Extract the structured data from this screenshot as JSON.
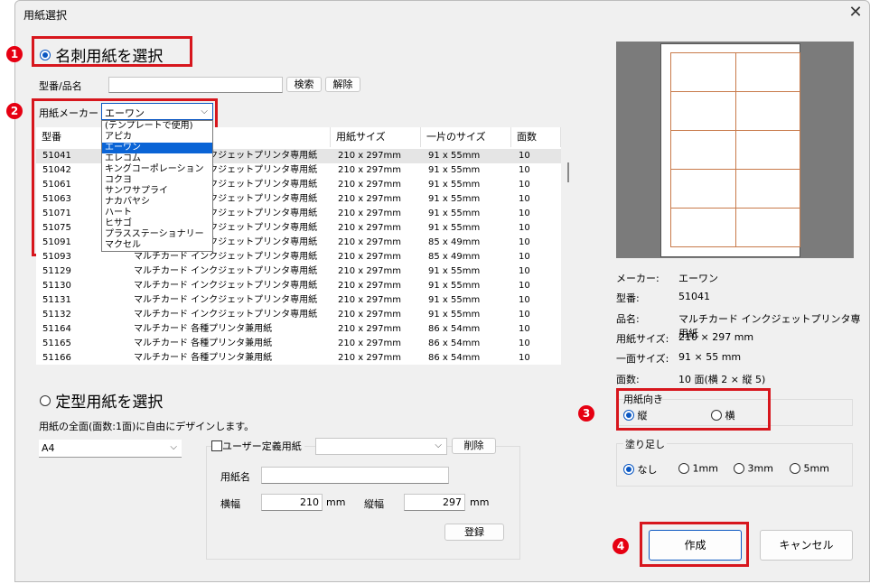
{
  "window": {
    "title": "用紙選択",
    "close_glyph": "✕"
  },
  "badges": {
    "b1": "1",
    "b2": "2",
    "b3": "3",
    "b4": "4"
  },
  "meishi": {
    "label": "名刺用紙を選択",
    "search_label": "型番/品名",
    "search_button": "検索",
    "clear_button": "解除",
    "maker_label": "用紙メーカー",
    "maker_value": "エーワン"
  },
  "maker_options": [
    "(テンプレートで使用)",
    "アピカ",
    "エーワン",
    "エレコム",
    "キングコーポレーション",
    "コクヨ",
    "サンワサプライ",
    "ナカバヤシ",
    "ハート",
    "ヒサゴ",
    "プラスステーショナリー",
    "マクセル"
  ],
  "columns": [
    "型番",
    "品名",
    "用紙サイズ",
    "一片のサイズ",
    "面数"
  ],
  "rows": [
    {
      "no": "51041",
      "name": "マルチカード インクジェットプリンタ専用紙",
      "size": "210 x 297mm",
      "piece": "91 x 55mm",
      "count": "10"
    },
    {
      "no": "51042",
      "name": "マルチカード インクジェットプリンタ専用紙",
      "size": "210 x 297mm",
      "piece": "91 x 55mm",
      "count": "10"
    },
    {
      "no": "51061",
      "name": "マルチカード インクジェットプリンタ専用紙",
      "size": "210 x 297mm",
      "piece": "91 x 55mm",
      "count": "10"
    },
    {
      "no": "51063",
      "name": "マルチカード インクジェットプリンタ専用紙",
      "size": "210 x 297mm",
      "piece": "91 x 55mm",
      "count": "10"
    },
    {
      "no": "51071",
      "name": "マルチカード インクジェットプリンタ専用紙",
      "size": "210 x 297mm",
      "piece": "91 x 55mm",
      "count": "10"
    },
    {
      "no": "51075",
      "name": "マルチカード インクジェットプリンタ専用紙",
      "size": "210 x 297mm",
      "piece": "91 x 55mm",
      "count": "10"
    },
    {
      "no": "51091",
      "name": "マルチカード インクジェットプリンタ専用紙",
      "size": "210 x 297mm",
      "piece": "85 x 49mm",
      "count": "10"
    },
    {
      "no": "51093",
      "name": "マルチカード インクジェットプリンタ専用紙",
      "size": "210 x 297mm",
      "piece": "85 x 49mm",
      "count": "10"
    },
    {
      "no": "51129",
      "name": "マルチカード インクジェットプリンタ専用紙",
      "size": "210 x 297mm",
      "piece": "91 x 55mm",
      "count": "10"
    },
    {
      "no": "51130",
      "name": "マルチカード インクジェットプリンタ専用紙",
      "size": "210 x 297mm",
      "piece": "91 x 55mm",
      "count": "10"
    },
    {
      "no": "51131",
      "name": "マルチカード インクジェットプリンタ専用紙",
      "size": "210 x 297mm",
      "piece": "91 x 55mm",
      "count": "10"
    },
    {
      "no": "51132",
      "name": "マルチカード インクジェットプリンタ専用紙",
      "size": "210 x 297mm",
      "piece": "91 x 55mm",
      "count": "10"
    },
    {
      "no": "51164",
      "name": "マルチカード 各種プリンタ兼用紙",
      "size": "210 x 297mm",
      "piece": "86 x 54mm",
      "count": "10"
    },
    {
      "no": "51165",
      "name": "マルチカード 各種プリンタ兼用紙",
      "size": "210 x 297mm",
      "piece": "86 x 54mm",
      "count": "10"
    },
    {
      "no": "51166",
      "name": "マルチカード 各種プリンタ兼用紙",
      "size": "210 x 297mm",
      "piece": "86 x 54mm",
      "count": "10"
    }
  ],
  "teikei": {
    "label": "定型用紙を選択",
    "desc": "用紙の全面(面数:1面)に自由にデザインします。",
    "size_value": "A4",
    "user_label": "ユーザー定義用紙",
    "delete_button": "削除",
    "name_label": "用紙名",
    "width_label": "横幅",
    "width_value": "210",
    "width_unit": "mm",
    "height_label": "縦幅",
    "height_value": "297",
    "height_unit": "mm",
    "register_button": "登録"
  },
  "info": [
    {
      "k": "メーカー:",
      "v": "エーワン"
    },
    {
      "k": "型番:",
      "v": "51041"
    },
    {
      "k": "品名:",
      "v": "マルチカード インクジェットプリンタ専用紙"
    },
    {
      "k": "用紙サイズ:",
      "v": "210 × 297 mm"
    },
    {
      "k": "一面サイズ:",
      "v": "91 × 55 mm"
    },
    {
      "k": "面数:",
      "v": "10 面(横 2 × 縦 5)"
    }
  ],
  "orientation": {
    "label": "用紙向き",
    "portrait": "縦",
    "landscape": "横"
  },
  "bleed": {
    "label": "塗り足し",
    "none": "なし",
    "opt1": "1mm",
    "opt3": "3mm",
    "opt5": "5mm"
  },
  "buttons": {
    "create": "作成",
    "cancel": "キャンセル"
  },
  "colors": {
    "accent": "#0a57c2",
    "highlight": "#d7161d",
    "selection": "#0a64d6"
  }
}
